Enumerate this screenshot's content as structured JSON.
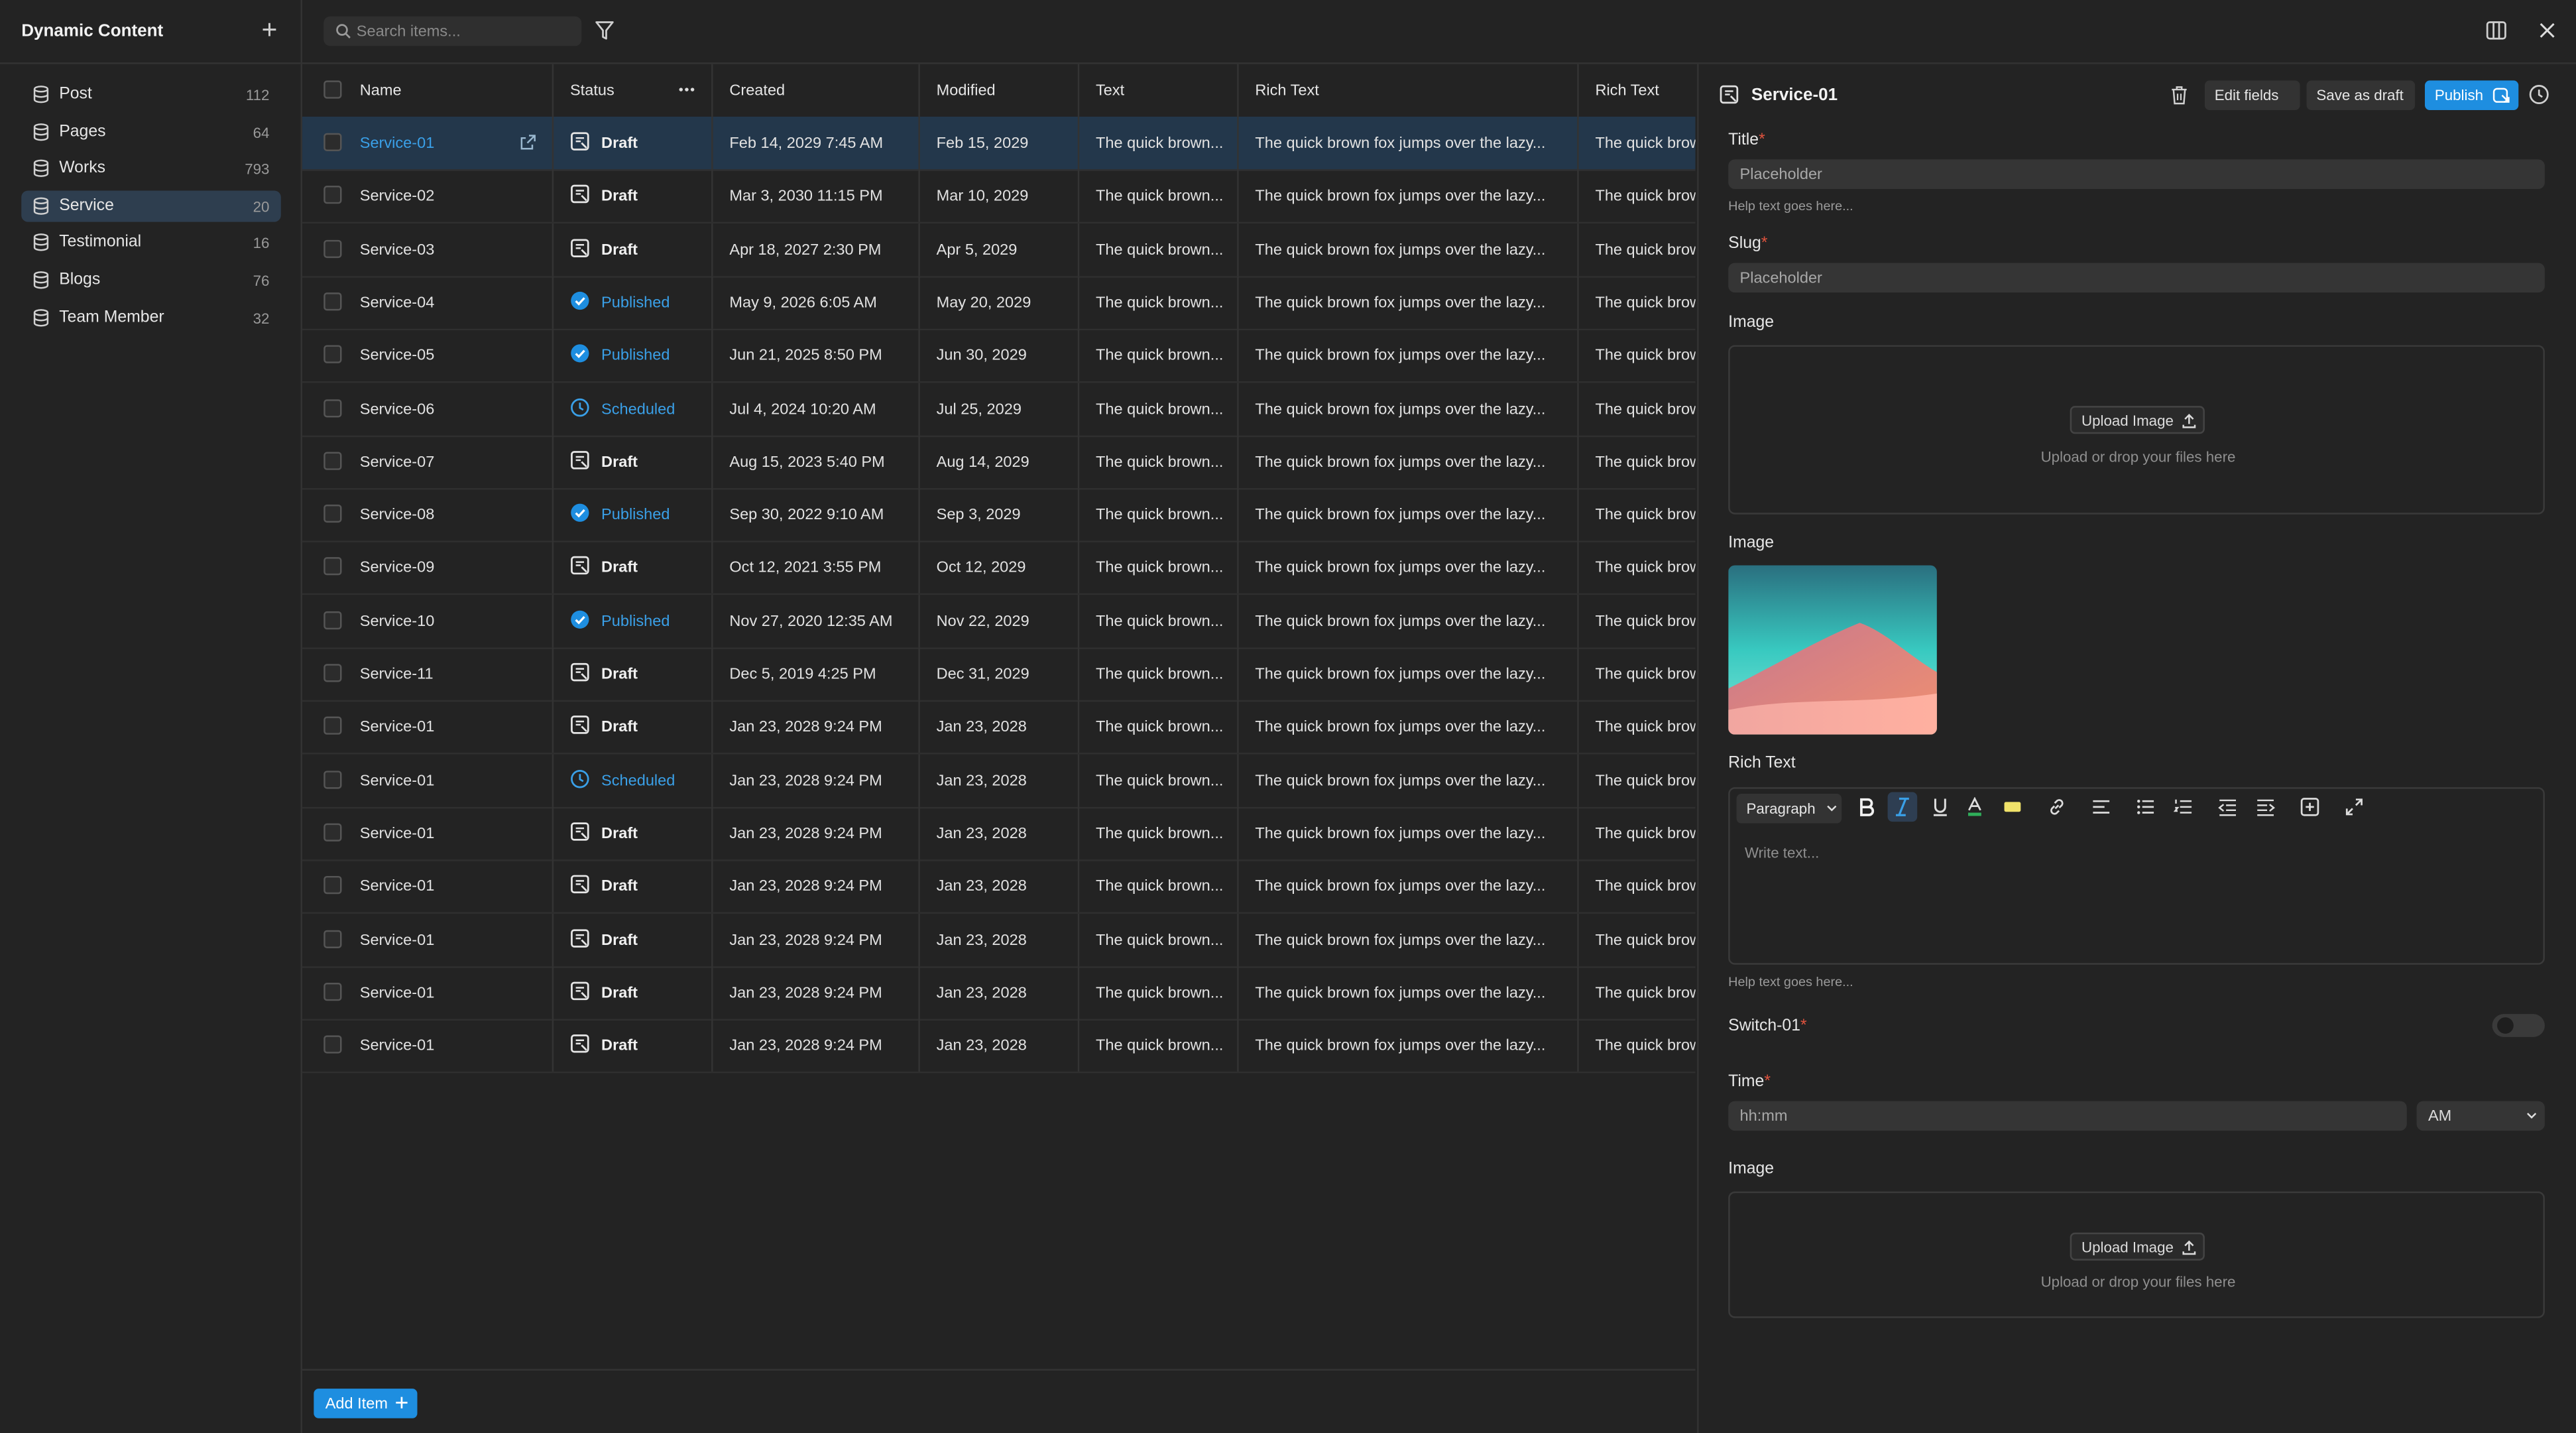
{
  "sidebar": {
    "title": "Dynamic Content",
    "items": [
      {
        "label": "Post",
        "count": "112"
      },
      {
        "label": "Pages",
        "count": "64"
      },
      {
        "label": "Works",
        "count": "793"
      },
      {
        "label": "Service",
        "count": "20"
      },
      {
        "label": "Testimonial",
        "count": "16"
      },
      {
        "label": "Blogs",
        "count": "76"
      },
      {
        "label": "Team Member",
        "count": "32"
      }
    ],
    "active_index": 3
  },
  "toolbar": {
    "search_placeholder": "Search items..."
  },
  "table": {
    "columns": [
      "Name",
      "Status",
      "Created",
      "Modified",
      "Text",
      "Rich Text",
      "Rich Text"
    ],
    "rows": [
      {
        "name": "Service-01",
        "status": "Draft",
        "created": "Feb 14, 2029 7:45 AM",
        "modified": "Feb 15, 2029",
        "text": "The quick brown...",
        "rich": "The quick brown fox jumps over the lazy...",
        "rich2": "The quick brow"
      },
      {
        "name": "Service-02",
        "status": "Draft",
        "created": "Mar 3, 2030 11:15 PM",
        "modified": "Mar 10, 2029",
        "text": "The quick brown...",
        "rich": "The quick brown fox jumps over the lazy...",
        "rich2": "The quick brow"
      },
      {
        "name": "Service-03",
        "status": "Draft",
        "created": "Apr 18, 2027 2:30 PM",
        "modified": "Apr 5, 2029",
        "text": "The quick brown...",
        "rich": "The quick brown fox jumps over the lazy...",
        "rich2": "The quick brow"
      },
      {
        "name": "Service-04",
        "status": "Published",
        "created": "May 9, 2026 6:05 AM",
        "modified": "May 20, 2029",
        "text": "The quick brown...",
        "rich": "The quick brown fox jumps over the lazy...",
        "rich2": "The quick brow"
      },
      {
        "name": "Service-05",
        "status": "Published",
        "created": "Jun 21, 2025 8:50 PM",
        "modified": "Jun 30, 2029",
        "text": "The quick brown...",
        "rich": "The quick brown fox jumps over the lazy...",
        "rich2": "The quick brow"
      },
      {
        "name": "Service-06",
        "status": "Scheduled",
        "created": "Jul 4, 2024 10:20 AM",
        "modified": "Jul 25, 2029",
        "text": "The quick brown...",
        "rich": "The quick brown fox jumps over the lazy...",
        "rich2": "The quick brow"
      },
      {
        "name": "Service-07",
        "status": "Draft",
        "created": "Aug 15, 2023 5:40 PM",
        "modified": "Aug 14, 2029",
        "text": "The quick brown...",
        "rich": "The quick brown fox jumps over the lazy...",
        "rich2": "The quick brow"
      },
      {
        "name": "Service-08",
        "status": "Published",
        "created": "Sep 30, 2022 9:10 AM",
        "modified": "Sep 3, 2029",
        "text": "The quick brown...",
        "rich": "The quick brown fox jumps over the lazy...",
        "rich2": "The quick brow"
      },
      {
        "name": "Service-09",
        "status": "Draft",
        "created": "Oct 12, 2021 3:55 PM",
        "modified": "Oct 12, 2029",
        "text": "The quick brown...",
        "rich": "The quick brown fox jumps over the lazy...",
        "rich2": "The quick brow"
      },
      {
        "name": "Service-10",
        "status": "Published",
        "created": "Nov 27, 2020 12:35 AM",
        "modified": "Nov 22, 2029",
        "text": "The quick brown...",
        "rich": "The quick brown fox jumps over the lazy...",
        "rich2": "The quick brow"
      },
      {
        "name": "Service-11",
        "status": "Draft",
        "created": "Dec 5, 2019 4:25 PM",
        "modified": "Dec 31, 2029",
        "text": "The quick brown...",
        "rich": "The quick brown fox jumps over the lazy...",
        "rich2": "The quick brow"
      },
      {
        "name": "Service-01",
        "status": "Draft",
        "created": "Jan 23, 2028 9:24 PM",
        "modified": "Jan 23, 2028",
        "text": "The quick brown...",
        "rich": "The quick brown fox jumps over the lazy...",
        "rich2": "The quick brow"
      },
      {
        "name": "Service-01",
        "status": "Scheduled",
        "created": "Jan 23, 2028 9:24 PM",
        "modified": "Jan 23, 2028",
        "text": "The quick brown...",
        "rich": "The quick brown fox jumps over the lazy...",
        "rich2": "The quick brow"
      },
      {
        "name": "Service-01",
        "status": "Draft",
        "created": "Jan 23, 2028 9:24 PM",
        "modified": "Jan 23, 2028",
        "text": "The quick brown...",
        "rich": "The quick brown fox jumps over the lazy...",
        "rich2": "The quick brow"
      },
      {
        "name": "Service-01",
        "status": "Draft",
        "created": "Jan 23, 2028 9:24 PM",
        "modified": "Jan 23, 2028",
        "text": "The quick brown...",
        "rich": "The quick brown fox jumps over the lazy...",
        "rich2": "The quick brow"
      },
      {
        "name": "Service-01",
        "status": "Draft",
        "created": "Jan 23, 2028 9:24 PM",
        "modified": "Jan 23, 2028",
        "text": "The quick brown...",
        "rich": "The quick brown fox jumps over the lazy...",
        "rich2": "The quick brow"
      },
      {
        "name": "Service-01",
        "status": "Draft",
        "created": "Jan 23, 2028 9:24 PM",
        "modified": "Jan 23, 2028",
        "text": "The quick brown...",
        "rich": "The quick brown fox jumps over the lazy...",
        "rich2": "The quick brow"
      },
      {
        "name": "Service-01",
        "status": "Draft",
        "created": "Jan 23, 2028 9:24 PM",
        "modified": "Jan 23, 2028",
        "text": "The quick brown...",
        "rich": "The quick brown fox jumps over the lazy...",
        "rich2": "The quick brow"
      }
    ],
    "selected_index": 0,
    "add_item_label": "Add Item"
  },
  "panel": {
    "title": "Service-01",
    "edit_fields_label": "Edit fields",
    "save_draft_label": "Save as draft",
    "publish_label": "Publish",
    "title_field": {
      "label": "Title",
      "placeholder": "Placeholder",
      "help": "Help text goes here..."
    },
    "slug_field": {
      "label": "Slug",
      "placeholder": "Placeholder"
    },
    "image1": {
      "label": "Image",
      "button": "Upload Image",
      "hint": "Upload or drop your files here"
    },
    "image2": {
      "label": "Image"
    },
    "rich_text": {
      "label": "Rich Text",
      "paragraph": "Paragraph",
      "placeholder": "Write text...",
      "help": "Help text goes here..."
    },
    "switch": {
      "label": "Switch-01",
      "on": false
    },
    "time": {
      "label": "Time",
      "placeholder": "hh:mm",
      "ampm": "AM"
    },
    "image3": {
      "label": "Image",
      "button": "Upload Image",
      "hint": "Upload or drop your files here"
    }
  },
  "colors": {
    "accent": "#1e8ee0",
    "link": "#3aa0e8",
    "required": "#e0533e",
    "background": "#232323"
  }
}
